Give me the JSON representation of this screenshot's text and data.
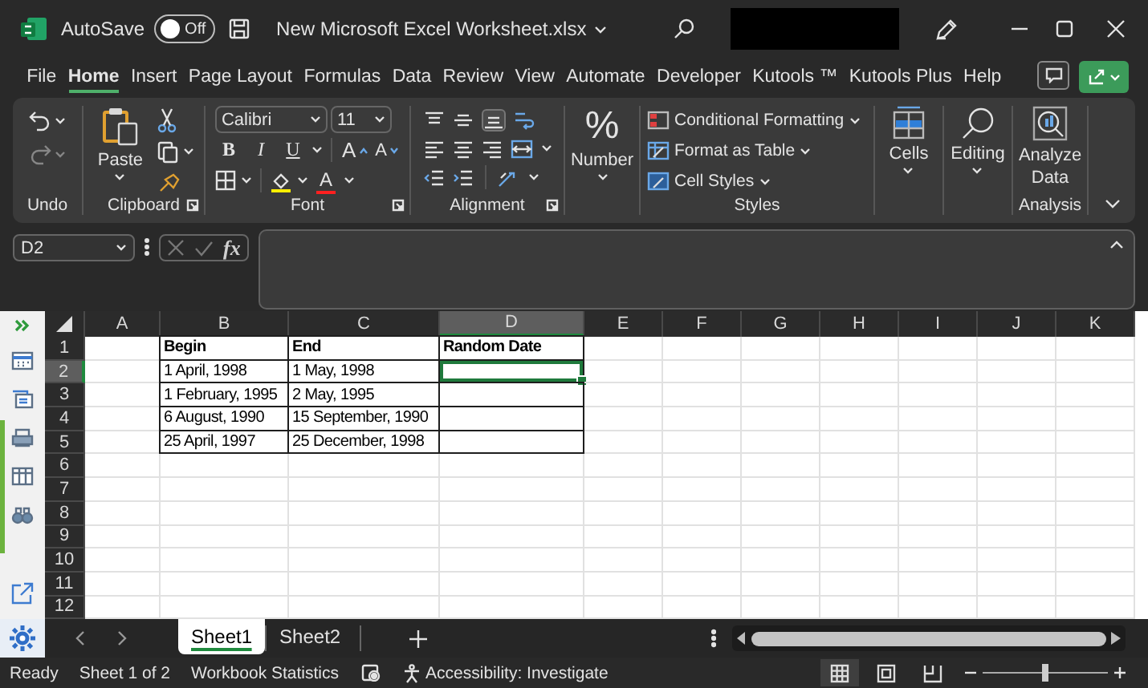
{
  "title_bar": {
    "autosave_label": "AutoSave",
    "autosave": {
      "on": false,
      "label": "Off"
    },
    "file_name": "New Microsoft Excel Worksheet.xlsx"
  },
  "menu_tabs": [
    {
      "label": "File",
      "selected": false
    },
    {
      "label": "Home",
      "selected": true
    },
    {
      "label": "Insert",
      "selected": false
    },
    {
      "label": "Page Layout",
      "selected": false
    },
    {
      "label": "Formulas",
      "selected": false
    },
    {
      "label": "Data",
      "selected": false
    },
    {
      "label": "Review",
      "selected": false
    },
    {
      "label": "View",
      "selected": false
    },
    {
      "label": "Automate",
      "selected": false
    },
    {
      "label": "Developer",
      "selected": false
    },
    {
      "label": "Kutools ™",
      "selected": false
    },
    {
      "label": "Kutools Plus",
      "selected": false
    },
    {
      "label": "Help",
      "selected": false
    }
  ],
  "ribbon": {
    "groups": [
      {
        "kind": "undo",
        "label": "Undo"
      },
      {
        "kind": "clipboard",
        "label": "Clipboard",
        "paste": "Paste"
      },
      {
        "kind": "font",
        "label": "Font",
        "font_name": "Calibri",
        "font_size": "11",
        "bold": "B",
        "italic": "I",
        "underline": "U",
        "grow": "A",
        "shrink": "A",
        "font_color": "A"
      },
      {
        "kind": "alignment",
        "label": "Alignment"
      },
      {
        "kind": "number",
        "symbol": "%",
        "button": "Number"
      },
      {
        "kind": "styles",
        "label": "Styles",
        "items": [
          "Conditional Formatting",
          "Format as Table",
          "Cell Styles"
        ]
      },
      {
        "kind": "cells",
        "button": "Cells"
      },
      {
        "kind": "editing",
        "button": "Editing"
      },
      {
        "kind": "analysis",
        "label": "Analysis",
        "button": "Analyze Data"
      }
    ]
  },
  "formula_bar": {
    "name_box": "D2",
    "function_label": "fx"
  },
  "grid": {
    "columns": [
      {
        "label": "A",
        "selected": false
      },
      {
        "label": "B",
        "selected": false
      },
      {
        "label": "C",
        "selected": false
      },
      {
        "label": "D",
        "selected": true
      },
      {
        "label": "E",
        "selected": false
      },
      {
        "label": "F",
        "selected": false
      },
      {
        "label": "G",
        "selected": false
      },
      {
        "label": "H",
        "selected": false
      },
      {
        "label": "I",
        "selected": false
      },
      {
        "label": "J",
        "selected": false
      },
      {
        "label": "K",
        "selected": false
      }
    ],
    "rows": [
      {
        "header": "1",
        "selected": false,
        "bold": true,
        "bordered": true,
        "cells": [
          "",
          "Begin",
          "End",
          "Random Date"
        ]
      },
      {
        "header": "2",
        "selected": true,
        "bold": false,
        "bordered": true,
        "cells": [
          "",
          "1 April, 1998",
          "1 May, 1998",
          ""
        ]
      },
      {
        "header": "3",
        "selected": false,
        "bold": false,
        "bordered": true,
        "cells": [
          "",
          "1 February, 1995",
          "2 May, 1995",
          ""
        ]
      },
      {
        "header": "4",
        "selected": false,
        "bold": false,
        "bordered": true,
        "cells": [
          "",
          "6 August, 1990",
          "15 September, 1990",
          ""
        ]
      },
      {
        "header": "5",
        "selected": false,
        "bold": false,
        "bordered": true,
        "cells": [
          "",
          "25 April, 1997",
          "25 December, 1998",
          ""
        ]
      },
      {
        "header": "6",
        "selected": false
      },
      {
        "header": "7",
        "selected": false
      },
      {
        "header": "8",
        "selected": false
      },
      {
        "header": "9",
        "selected": false
      },
      {
        "header": "10",
        "selected": false
      },
      {
        "header": "11",
        "selected": false
      },
      {
        "header": "12",
        "selected": false
      }
    ]
  },
  "sheet_tabs": [
    {
      "label": "Sheet1",
      "selected": true
    },
    {
      "label": "Sheet2",
      "selected": false
    }
  ],
  "status_bar": {
    "ready": "Ready",
    "sheet_info": "Sheet 1 of 2",
    "statistics": "Workbook Statistics",
    "accessibility": "Accessibility: Investigate",
    "views": [
      {
        "kind": "normal",
        "selected": true
      },
      {
        "kind": "page-layout",
        "selected": false
      },
      {
        "kind": "page-break",
        "selected": false
      }
    ],
    "zoom": {
      "level": 0.5
    }
  }
}
